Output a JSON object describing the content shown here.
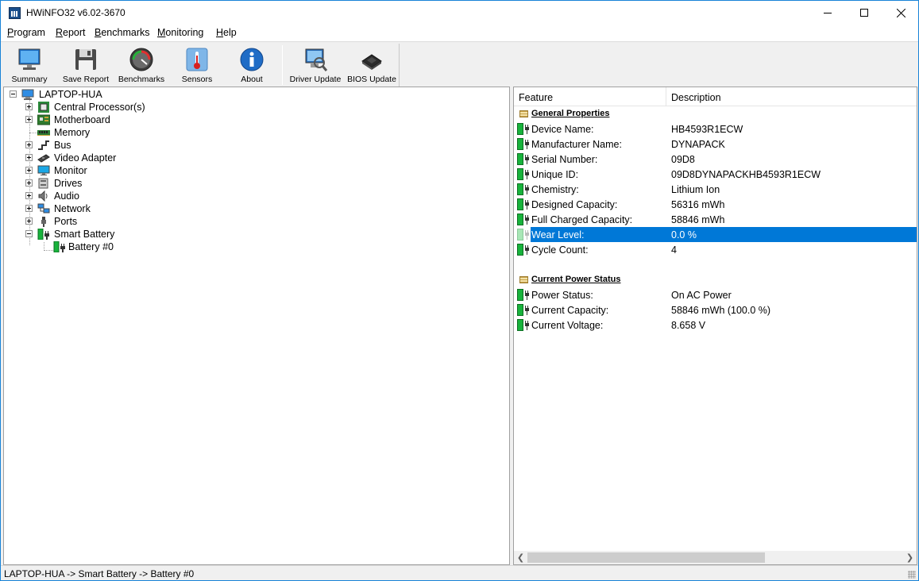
{
  "window": {
    "title": "HWiNFO32 v6.02-3670"
  },
  "menu": [
    {
      "label": "Program",
      "key": "P",
      "rest": "rogram"
    },
    {
      "label": "Report",
      "key": "R",
      "rest": "eport"
    },
    {
      "label": "Benchmarks",
      "key": "B",
      "rest": "enchmarks"
    },
    {
      "label": "Monitoring",
      "key": "M",
      "rest": "onitoring"
    },
    {
      "label": "Help",
      "key": "H",
      "rest": "elp"
    }
  ],
  "toolbar": {
    "summary": "Summary",
    "save_report": "Save Report",
    "benchmarks": "Benchmarks",
    "sensors": "Sensors",
    "about": "About",
    "driver_update": "Driver Update",
    "bios_update": "BIOS Update"
  },
  "tree": {
    "root": "LAPTOP-HUA",
    "items": [
      {
        "label": "Central Processor(s)",
        "icon": "cpu-icon"
      },
      {
        "label": "Motherboard",
        "icon": "motherboard-icon"
      },
      {
        "label": "Memory",
        "icon": "memory-icon"
      },
      {
        "label": "Bus",
        "icon": "bus-icon"
      },
      {
        "label": "Video Adapter",
        "icon": "video-adapter-icon"
      },
      {
        "label": "Monitor",
        "icon": "monitor-icon"
      },
      {
        "label": "Drives",
        "icon": "drives-icon"
      },
      {
        "label": "Audio",
        "icon": "audio-icon"
      },
      {
        "label": "Network",
        "icon": "network-icon"
      },
      {
        "label": "Ports",
        "icon": "ports-icon"
      },
      {
        "label": "Smart Battery",
        "icon": "battery-icon"
      }
    ],
    "child": "Battery #0"
  },
  "details": {
    "columns": {
      "feature": "Feature",
      "description": "Description"
    },
    "general_title": "General Properties",
    "general": [
      {
        "feature": "Device Name:",
        "value": "HB4593R1ECW"
      },
      {
        "feature": "Manufacturer Name:",
        "value": "DYNAPACK"
      },
      {
        "feature": "Serial Number:",
        "value": "09D8"
      },
      {
        "feature": "Unique ID:",
        "value": "09D8DYNAPACKHB4593R1ECW"
      },
      {
        "feature": "Chemistry:",
        "value": "Lithium Ion"
      },
      {
        "feature": "Designed Capacity:",
        "value": "56316 mWh"
      },
      {
        "feature": "Full Charged Capacity:",
        "value": "58846 mWh"
      },
      {
        "feature": "Wear Level:",
        "value": "0.0 %"
      },
      {
        "feature": "Cycle Count:",
        "value": "4"
      }
    ],
    "power_title": "Current Power Status",
    "power": [
      {
        "feature": "Power Status:",
        "value": "On AC Power"
      },
      {
        "feature": "Current Capacity:",
        "value": "58846 mWh (100.0 %)"
      },
      {
        "feature": "Current Voltage:",
        "value": "8.658 V"
      }
    ],
    "selected_row": "Wear Level:"
  },
  "status": {
    "path": "LAPTOP-HUA -> Smart Battery -> Battery #0"
  },
  "colors": {
    "selection": "#0078d7",
    "battery": "#18b33c",
    "border": "#1883d7"
  }
}
